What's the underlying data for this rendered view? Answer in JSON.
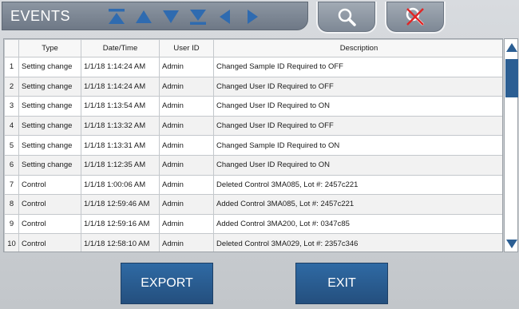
{
  "header": {
    "title": "EVENTS",
    "nav_icons": [
      "first-page-icon",
      "page-up-icon",
      "page-down-icon",
      "last-page-icon",
      "scroll-left-icon",
      "scroll-right-icon"
    ],
    "search_icon": "search-icon",
    "clear_filter_icon": "clear-filter-icon"
  },
  "table": {
    "columns": [
      "",
      "Type",
      "Date/Time",
      "User ID",
      "Description"
    ],
    "rows": [
      {
        "num": "1",
        "type": "Setting change",
        "datetime": "1/1/18 1:14:24 AM",
        "user": "Admin",
        "desc": "Changed Sample ID Required to OFF"
      },
      {
        "num": "2",
        "type": "Setting change",
        "datetime": "1/1/18 1:14:24 AM",
        "user": "Admin",
        "desc": "Changed User ID Required to OFF"
      },
      {
        "num": "3",
        "type": "Setting change",
        "datetime": "1/1/18 1:13:54 AM",
        "user": "Admin",
        "desc": "Changed User ID Required to ON"
      },
      {
        "num": "4",
        "type": "Setting change",
        "datetime": "1/1/18 1:13:32 AM",
        "user": "Admin",
        "desc": "Changed User ID Required to OFF"
      },
      {
        "num": "5",
        "type": "Setting change",
        "datetime": "1/1/18 1:13:31 AM",
        "user": "Admin",
        "desc": "Changed Sample ID Required to ON"
      },
      {
        "num": "6",
        "type": "Setting change",
        "datetime": "1/1/18 1:12:35 AM",
        "user": "Admin",
        "desc": "Changed User ID Required to ON"
      },
      {
        "num": "7",
        "type": "Control",
        "datetime": "1/1/18 1:00:06 AM",
        "user": "Admin",
        "desc": "Deleted Control 3MA085, Lot #: 2457c221"
      },
      {
        "num": "8",
        "type": "Control",
        "datetime": "1/1/18 12:59:46 AM",
        "user": "Admin",
        "desc": "Added Control 3MA085, Lot #: 2457c221"
      },
      {
        "num": "9",
        "type": "Control",
        "datetime": "1/1/18 12:59:16 AM",
        "user": "Admin",
        "desc": "Added Control 3MA200, Lot #: 0347c85"
      },
      {
        "num": "10",
        "type": "Control",
        "datetime": "1/1/18 12:58:10 AM",
        "user": "Admin",
        "desc": "Deleted Control 3MA029, Lot #: 2357c346"
      }
    ]
  },
  "footer": {
    "export_label": "EXPORT",
    "exit_label": "EXIT"
  },
  "colors": {
    "accent": "#2b5e93",
    "nav_arrow": "#2f6bb0",
    "clear_x": "#e02626"
  }
}
